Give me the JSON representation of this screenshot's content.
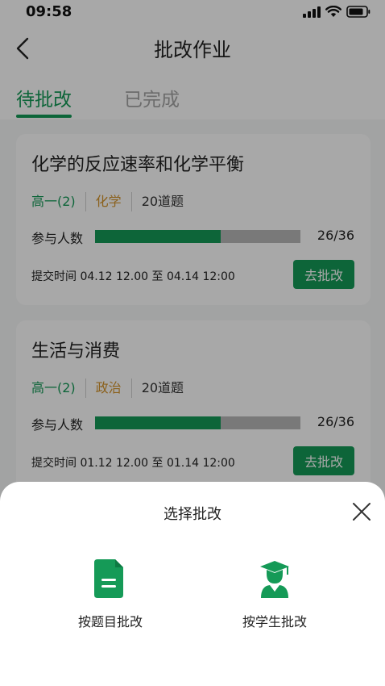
{
  "status_bar": {
    "time": "09:58"
  },
  "nav": {
    "title": "批改作业"
  },
  "tabs": [
    {
      "label": "待批改",
      "active": true
    },
    {
      "label": "已完成",
      "active": false
    }
  ],
  "cards": [
    {
      "title": "化学的反应速率和化学平衡",
      "class_tag": "高一(2)",
      "subject_tag": "化学",
      "question_count": "20道题",
      "progress_label": "参与人数",
      "progress_text": "26/36",
      "progress_fraction": 0.61,
      "submit_time": "提交时间 04.12 12.00 至 04.14 12:00",
      "button": "去批改"
    },
    {
      "title": "生活与消费",
      "class_tag": "高一(2)",
      "subject_tag": "政治",
      "question_count": "20道题",
      "progress_label": "参与人数",
      "progress_text": "26/36",
      "progress_fraction": 0.61,
      "submit_time": "提交时间 01.12 12.00 至 01.14 12:00",
      "button": "去批改"
    }
  ],
  "sheet": {
    "title": "选择批改",
    "options": [
      {
        "label": "按题目批改",
        "icon": "document-icon"
      },
      {
        "label": "按学生批改",
        "icon": "graduate-icon"
      }
    ]
  },
  "colors": {
    "accent": "#159a57",
    "subject": "#d4932b",
    "inactive_tab": "#a4a4a4",
    "progress_track": "#b8b8b8"
  }
}
